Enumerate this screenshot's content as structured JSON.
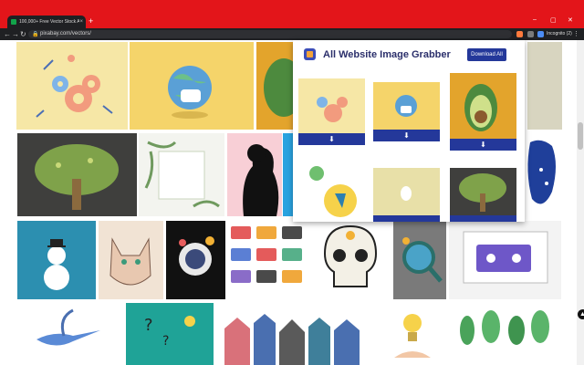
{
  "browser": {
    "tab_title": "100,000+ Free Vector Stock Art I",
    "tab_close": "×",
    "new_tab": "+",
    "min": "–",
    "max": "▢",
    "close": "✕",
    "url": "pixabay.com/vectors/",
    "profile": "Incognito (2)",
    "colors": {
      "strip": "#e3151a",
      "toolbar": "#1f2023"
    }
  },
  "popup": {
    "title": "All Website Image Grabber",
    "download_all": "Download All",
    "download_glyph": "⬇"
  }
}
